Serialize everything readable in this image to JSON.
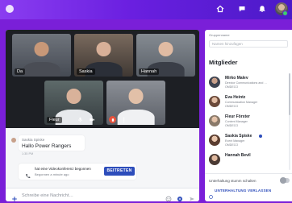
{
  "colors": {
    "brand_gradient_start": "#8a3df0",
    "brand_gradient_end": "#4b1ac8",
    "primary": "#2d4dbb",
    "danger": "#e8513b",
    "online": "#3ccf6b"
  },
  "topbar": {
    "icons": [
      "home-icon",
      "chat-icon",
      "bell-icon",
      "settings-icon"
    ]
  },
  "video": {
    "tiles": [
      {
        "label": "Da"
      },
      {
        "label": "Saskia"
      },
      {
        "label": "Hannah"
      },
      {
        "label": "Fleur"
      },
      {
        "label": ""
      }
    ],
    "controls": [
      "mic-icon",
      "camera-icon",
      "hangup-icon",
      "more-icon"
    ]
  },
  "chat": {
    "message": {
      "sender": "Saskia Spiske",
      "text": "Hallo Power Rangers",
      "time": "1:35 PM"
    },
    "join": {
      "title": "hat eine Videokonferenz begonnen",
      "time": "Begonnen a minute ago",
      "button": "BEITRETEN"
    },
    "compose_placeholder": "Schreibe eine Nachricht…"
  },
  "side": {
    "group_label": "Gruppenname",
    "group_placeholder": "Namen hinzufügen",
    "members_title": "Mitglieder",
    "members": [
      {
        "name": "Mirko Malev",
        "role": "Director Communications and …",
        "org": "OMDECO"
      },
      {
        "name": "Eva Heintz",
        "role": "Communication Manager",
        "org": "OMDECO"
      },
      {
        "name": "Fleur Förster",
        "role": "Content Manager",
        "org": "OMDECO"
      },
      {
        "name": "Saskia Spiske",
        "role": "Event Manager",
        "org": "OMDECO"
      },
      {
        "name": "Hannah Bevil",
        "role": "",
        "org": ""
      }
    ],
    "mute_label": "Unterhaltung stumm schalten",
    "mute_on": false,
    "leave_label": "UNTERHALTUNG VERLASSEN"
  }
}
